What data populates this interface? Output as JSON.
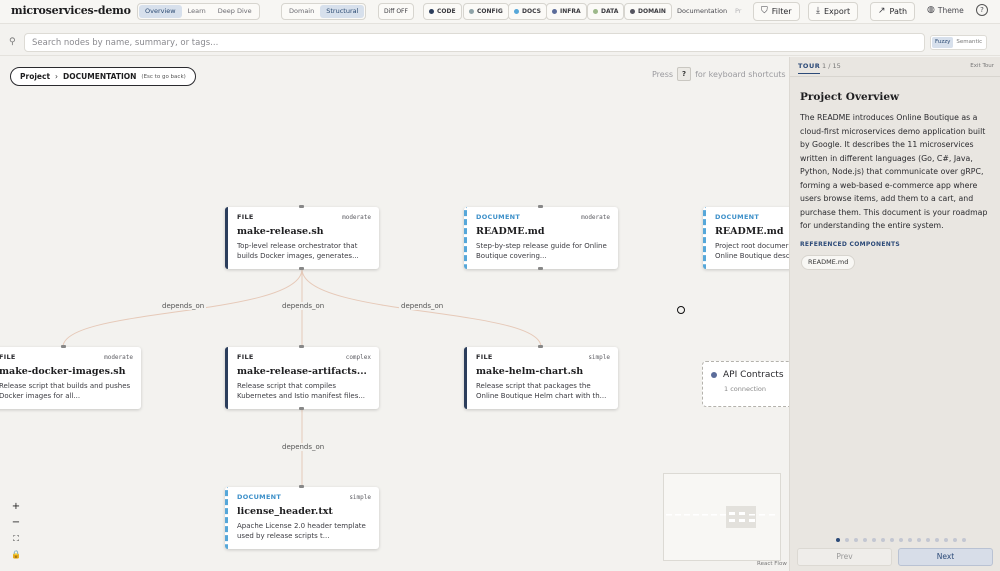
{
  "header": {
    "app_title": "microservices-demo",
    "views": [
      {
        "label": "Overview",
        "active": true
      },
      {
        "label": "Learn",
        "active": false
      },
      {
        "label": "Deep Dive",
        "active": false
      }
    ],
    "modes": [
      {
        "label": "Domain",
        "active": false
      },
      {
        "label": "Structural",
        "active": true
      }
    ],
    "diff_label": "Diff OFF",
    "categories": [
      {
        "label": "CODE",
        "color": "#2c3e5c"
      },
      {
        "label": "CONFIG",
        "color": "#8fa3a8"
      },
      {
        "label": "DOCS",
        "color": "#56a7d9"
      },
      {
        "label": "INFRA",
        "color": "#5b6c9a"
      },
      {
        "label": "DATA",
        "color": "#9cb88a"
      },
      {
        "label": "DOMAIN",
        "color": "#555560"
      }
    ],
    "documentation_label": "Documentation",
    "truncated_label": "Pr",
    "filter_label": "Filter",
    "export_label": "Export",
    "path_label": "Path",
    "theme_label": "Theme"
  },
  "search": {
    "placeholder": "Search nodes by name, summary, or tags...",
    "modes": [
      {
        "label": "Fuzzy",
        "active": true
      },
      {
        "label": "Semantic",
        "active": false
      }
    ]
  },
  "canvas": {
    "breadcrumb": {
      "root": "Project",
      "separator": "›",
      "current": "DOCUMENTATION",
      "hint": "(Esc to go back)"
    },
    "keyboard_hint": {
      "before": "Press",
      "key": "?",
      "after": "for keyboard shortcuts"
    },
    "nodes": [
      {
        "id": "make-release",
        "kind": "FILE",
        "complexity": "moderate",
        "title": "make-release.sh",
        "summary": "Top-level release orchestrator that builds Docker images, generates..."
      },
      {
        "id": "readme-release",
        "kind": "DOCUMENT",
        "complexity": "moderate",
        "title": "README.md",
        "summary": "Step-by-step release guide for Online Boutique covering..."
      },
      {
        "id": "readme-root",
        "kind": "DOCUMENT",
        "complexity": "",
        "title": "README.md",
        "summary": "Project root documer Online Boutique desc"
      },
      {
        "id": "make-docker-images",
        "kind": "FILE",
        "complexity": "moderate",
        "title": "make-docker-images.sh",
        "summary": "Release script that builds and pushes Docker images for all..."
      },
      {
        "id": "make-release-artifacts",
        "kind": "FILE",
        "complexity": "complex",
        "title": "make-release-artifacts...",
        "summary": "Release script that compiles Kubernetes and Istio manifest files..."
      },
      {
        "id": "make-helm-chart",
        "kind": "FILE",
        "complexity": "simple",
        "title": "make-helm-chart.sh",
        "summary": "Release script that packages the Online Boutique Helm chart with th..."
      },
      {
        "id": "license-header",
        "kind": "DOCUMENT",
        "complexity": "simple",
        "title": "license_header.txt",
        "summary": "Apache License 2.0 header template used by release scripts t..."
      }
    ],
    "edge_labels": [
      "depends_on",
      "depends_on",
      "depends_on",
      "depends_on"
    ],
    "group": {
      "title": "API Contracts",
      "subtitle": "1 connection"
    },
    "attribution": "React Flow"
  },
  "tour": {
    "tab_label": "TOUR",
    "step": "1 / 15",
    "exit_label": "Exit Tour",
    "title": "Project Overview",
    "body": "The README introduces Online Boutique as a cloud-first microservices demo application built by Google. It describes the 11 microservices written in different languages (Go, C#, Java, Python, Node.js) that communicate over gRPC, forming a web-based e-commerce app where users browse items, add them to a cart, and purchase them. This document is your roadmap for understanding the entire system.",
    "referenced_heading": "REFERENCED COMPONENTS",
    "referenced": [
      "README.md"
    ],
    "current_step": 1,
    "total_steps": 15,
    "prev_label": "Prev",
    "next_label": "Next"
  }
}
